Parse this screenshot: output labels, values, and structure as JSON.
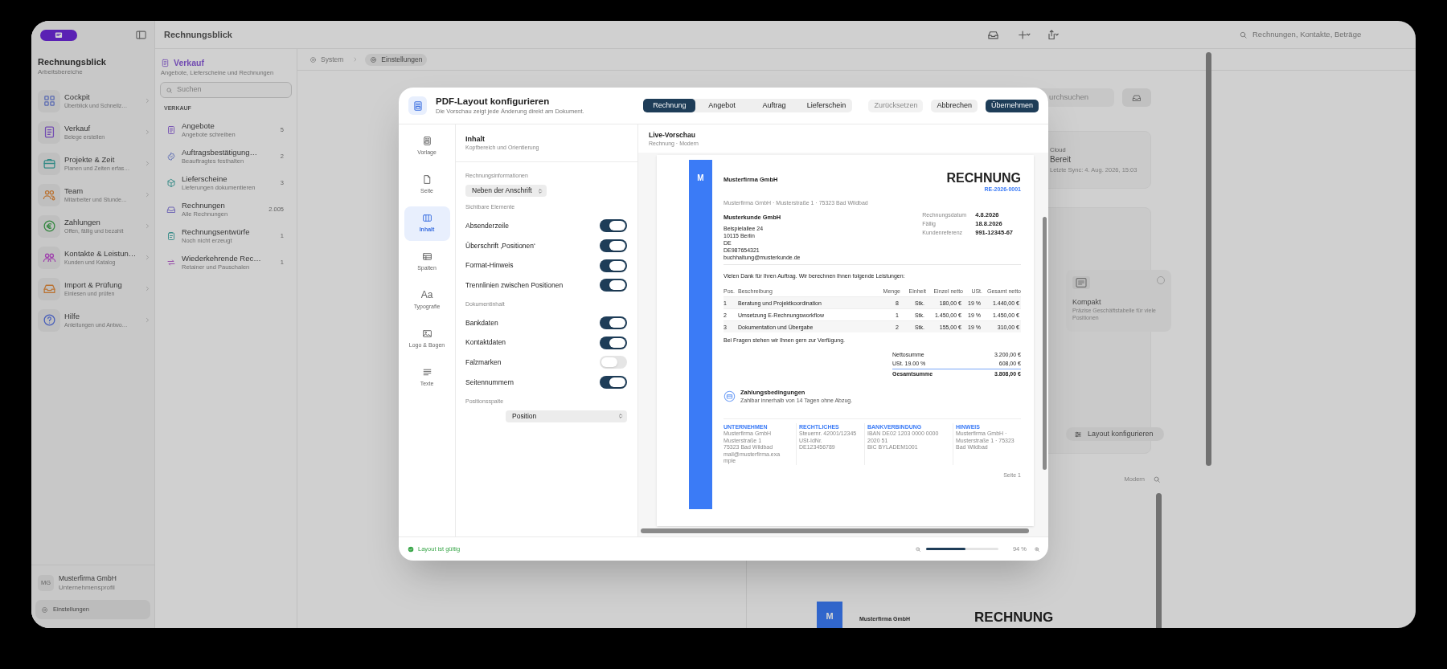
{
  "app": {
    "title": "Rechnungsblick",
    "search_placeholder": "Rechnungen, Kontakte, Beträge"
  },
  "sidebar": {
    "title": "Rechnungsblick",
    "subtitle": "Arbeitsbereiche",
    "items": [
      {
        "label": "Cockpit",
        "sublabel": "Überblick und Schnellz…"
      },
      {
        "label": "Verkauf",
        "sublabel": "Belege erstellen"
      },
      {
        "label": "Projekte & Zeit",
        "sublabel": "Planen und Zeiten erfas…"
      },
      {
        "label": "Team",
        "sublabel": "Mitarbeiter und Stunde…"
      },
      {
        "label": "Zahlungen",
        "sublabel": "Offen, fällig und bezahlt"
      },
      {
        "label": "Kontakte & Leistun…",
        "sublabel": "Kunden und Katalog"
      },
      {
        "label": "Import & Prüfung",
        "sublabel": "Einlesen und prüfen"
      },
      {
        "label": "Hilfe",
        "sublabel": "Anleitungen und Antwo…"
      }
    ],
    "profile": {
      "initials": "MG",
      "name": "Musterfirma GmbH",
      "subtitle": "Unternehmensprofil"
    },
    "settings_button": "Einstellungen"
  },
  "section_list": {
    "title": "Verkauf",
    "subtitle": "Angebote, Lieferscheine und Rechnungen",
    "search_placeholder": "Suchen",
    "group": "VERKAUF",
    "items": [
      {
        "label": "Angebote",
        "sublabel": "Angebote schreiben",
        "count": "5"
      },
      {
        "label": "Auftragsbestätigung…",
        "sublabel": "Beauftragtes festhalten",
        "count": "2"
      },
      {
        "label": "Lieferscheine",
        "sublabel": "Lieferungen dokumentieren",
        "count": "3"
      },
      {
        "label": "Rechnungen",
        "sublabel": "Alle Rechnungen",
        "count": "2.005"
      },
      {
        "label": "Rechnungsentwürfe",
        "sublabel": "Noch nicht erzeugt",
        "count": "1"
      },
      {
        "label": "Wiederkehrende Rec…",
        "sublabel": "Retainer und Pauschalen",
        "count": "1"
      }
    ]
  },
  "breadcrumbs": [
    {
      "label": "System",
      "selected": false
    },
    {
      "label": "Einstellungen",
      "selected": true
    }
  ],
  "background": {
    "search_text": "urchsuchen",
    "cloud": {
      "label": "Cloud",
      "status": "Bereit",
      "sync": "Letzte Sync: 4. Aug. 2026, 15:03"
    },
    "layout_option": {
      "title": "Kompakt",
      "description": "Präzise Geschäftstabelle für viele Positionen",
      "selected": false
    },
    "configure_button": "Layout konfigurieren",
    "preview_style": "Modern",
    "preview": {
      "logo": "M",
      "company": "Musterfirma GmbH",
      "title": "RECHNUNG"
    }
  },
  "dialog": {
    "title": "PDF-Layout konfigurieren",
    "subtitle": "Die Vorschau zeigt jede Änderung direkt am Dokument.",
    "document_types": [
      {
        "label": "Rechnung",
        "selected": true
      },
      {
        "label": "Angebot",
        "selected": false
      },
      {
        "label": "Auftrag",
        "selected": false
      },
      {
        "label": "Lieferschein",
        "selected": false
      }
    ],
    "actions": [
      {
        "label": "Zurücksetzen",
        "kind": "secondary",
        "disabled": true
      },
      {
        "label": "Abbrechen",
        "kind": "secondary",
        "disabled": false
      },
      {
        "label": "Übernehmen",
        "kind": "primary",
        "disabled": false
      }
    ],
    "nav": [
      {
        "label": "Vorlage",
        "selected": false
      },
      {
        "label": "Seite",
        "selected": false
      },
      {
        "label": "Inhalt",
        "selected": true
      },
      {
        "label": "Spalten",
        "selected": false
      },
      {
        "label": "Typografie",
        "glyph": "Aa",
        "selected": false
      },
      {
        "label": "Logo & Bogen",
        "selected": false
      },
      {
        "label": "Texte",
        "selected": false
      }
    ],
    "panel": {
      "title": "Inhalt",
      "subtitle": "Kopfbereich und Orientierung",
      "sections": [
        {
          "kind": "select",
          "heading": "Rechnungsinformationen",
          "value": "Neben der Anschrift"
        },
        {
          "kind": "toggles",
          "heading": "Sichtbare Elemente",
          "items": [
            {
              "label": "Absenderzeile",
              "on": true
            },
            {
              "label": "Überschrift ‚Positionen‘",
              "on": true
            },
            {
              "label": "Format-Hinweis",
              "on": true
            },
            {
              "label": "Trennlinien zwischen Positionen",
              "on": true
            }
          ]
        },
        {
          "kind": "toggles",
          "heading": "Dokumentinhalt",
          "items": [
            {
              "label": "Bankdaten",
              "on": true
            },
            {
              "label": "Kontaktdaten",
              "on": true
            },
            {
              "label": "Falzmarken",
              "on": false
            },
            {
              "label": "Seitennummern",
              "on": true
            }
          ]
        },
        {
          "kind": "select",
          "heading": "Positionsspalte",
          "value": "Position"
        }
      ]
    },
    "preview": {
      "title": "Live-Vorschau",
      "subtitle": "Rechnung · Modern"
    },
    "document": {
      "logo": "M",
      "sender_name": "Musterfirma GmbH",
      "title": "RECHNUNG",
      "number": "RE-2026-0001",
      "sender_line": "Musterfirma GmbH · Musterstraße 1 · 75323 Bad Wildbad",
      "recipient": {
        "name": "Musterkunde GmbH",
        "lines": [
          "Beispielallee 24",
          "10115 Berlin",
          "DE",
          "DE987654321",
          "buchhaltung@musterkunde.de"
        ]
      },
      "meta": [
        {
          "label": "Rechnungsdatum",
          "value": "4.8.2026"
        },
        {
          "label": "Fällig",
          "value": "18.8.2026"
        },
        {
          "label": "Kundenreferenz",
          "value": "991-12345-67"
        }
      ],
      "intro": "Vielen Dank für Ihren Auftrag. Wir berechnen Ihnen folgende Leistungen:",
      "table": {
        "columns": [
          "Pos.",
          "Beschreibung",
          "Menge",
          "Einheit",
          "Einzel netto",
          "USt.",
          "Gesamt netto"
        ],
        "rows": [
          [
            "1",
            "Beratung und Projektkoordination",
            "8",
            "Stk.",
            "180,00 €",
            "19 %",
            "1.440,00 €"
          ],
          [
            "2",
            "Umsetzung E-Rechnungsworkflow",
            "1",
            "Stk.",
            "1.450,00 €",
            "19 %",
            "1.450,00 €"
          ],
          [
            "3",
            "Dokumentation und Übergabe",
            "2",
            "Stk.",
            "155,00 €",
            "19 %",
            "310,00 €"
          ]
        ]
      },
      "closing": "Bei Fragen stehen wir Ihnen gern zur Verfügung.",
      "totals": [
        {
          "label": "Nettosumme",
          "value": "3.200,00 €"
        },
        {
          "label": "USt. 19.00 %",
          "value": "608,00 €"
        },
        {
          "label": "Gesamtsumme",
          "value": "3.808,00 €"
        }
      ],
      "payment": {
        "title": "Zahlungsbedingungen",
        "text": "Zahlbar innerhalb von 14 Tagen ohne Abzug."
      },
      "footer": [
        {
          "heading": "UNTERNEHMEN",
          "lines": [
            "Musterfirma GmbH",
            "Musterstraße 1",
            "75323 Bad Wildbad",
            "mail@musterfirma.exa",
            "mple"
          ]
        },
        {
          "heading": "RECHTLICHES",
          "lines": [
            "Steuernr. 42001/12345",
            "USt-IdNr.",
            "DE123456789"
          ]
        },
        {
          "heading": "BANKVERBINDUNG",
          "lines": [
            "IBAN DE02 1203 0000 0000",
            "2020 51",
            "BIC BYLADEM1001"
          ]
        },
        {
          "heading": "HINWEIS",
          "lines": [
            "Musterfirma GmbH ·",
            "Musterstraße 1 · 75323",
            "Bad Wildbad"
          ]
        }
      ],
      "page_label": "Seite 1"
    },
    "status": "Layout ist gültig",
    "zoom": {
      "level": 0.55,
      "reading": "94 %"
    }
  }
}
